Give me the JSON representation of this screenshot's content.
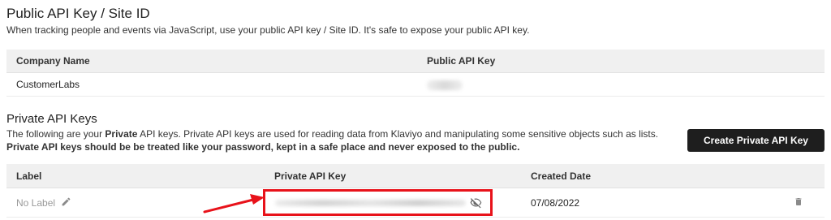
{
  "public_section": {
    "title": "Public API Key / Site ID",
    "description": "When tracking people and events via JavaScript, use your public API key / Site ID. It's safe to expose your public API key.",
    "table": {
      "headers": [
        "Company Name",
        "Public API Key"
      ],
      "rows": [
        {
          "company": "CustomerLabs"
        }
      ]
    }
  },
  "private_section": {
    "title": "Private API Keys",
    "description_prefix": "The following are your ",
    "description_bold": "Private",
    "description_suffix": " API keys. Private API keys are used for reading data from Klaviyo and manipulating some sensitive objects such as lists.",
    "warning": "Private API keys should be be treated like your password, kept in a safe place and never exposed to the public.",
    "create_button": "Create Private API Key",
    "table": {
      "headers": [
        "Label",
        "Private API Key",
        "Created Date"
      ],
      "rows": [
        {
          "label": "No Label",
          "created_date": "07/08/2022"
        }
      ]
    }
  },
  "icons": {
    "edit": "pencil-icon",
    "toggle_visibility": "eye-off-icon",
    "delete": "trash-icon",
    "annotation": "arrow-icon"
  },
  "colors": {
    "highlight": "#e8121a",
    "button_bg": "#1e1e1e",
    "header_bg": "#f0f0f0"
  }
}
